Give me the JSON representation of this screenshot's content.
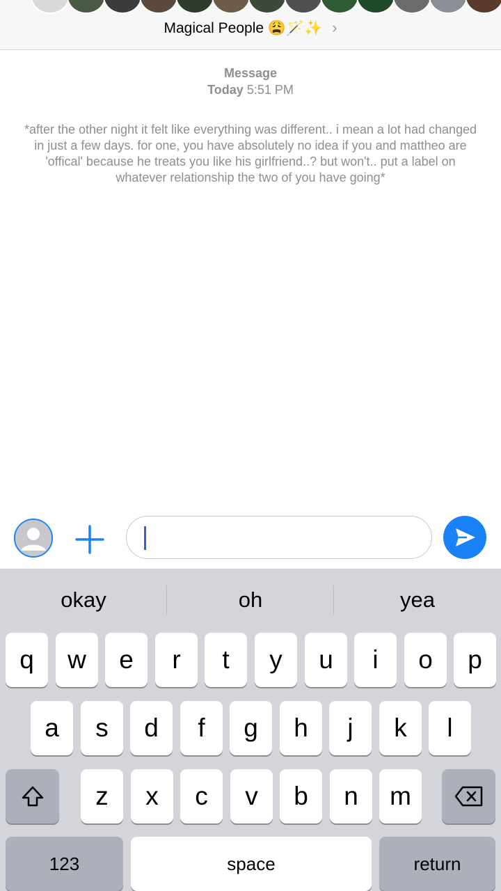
{
  "header": {
    "group_name": "Magical People",
    "group_emoji": "😩🪄✨",
    "chevron": "›",
    "avatar_colors": [
      "#d9d9d9",
      "#4a5a45",
      "#3a3a3a",
      "#5b4a3c",
      "#2f3b2d",
      "#6d5c48",
      "#3c4a3a",
      "#4f4f4f",
      "#2e5a35",
      "#1f4a2a",
      "#6b6b6b",
      "#8a8f95",
      "#5a3a2a",
      "#a08060"
    ]
  },
  "message": {
    "label": "Message",
    "date_bold": "Today",
    "time": "5:51 PM",
    "text": "*after the other night it felt like everything was different.. i mean a lot had changed in just a few days. for one, you have absolutely no idea if you and mattheo are 'offical' because he treats you like his girlfriend..? but won't.. put a label on whatever relationship the two of you have going*"
  },
  "input": {
    "value": "",
    "contact_icon": "person-icon",
    "plus_icon": "plus-icon",
    "send_icon": "send-icon",
    "accent": "#1a82f7"
  },
  "keyboard": {
    "suggestions": [
      "okay",
      "oh",
      "yea"
    ],
    "row1": [
      "q",
      "w",
      "e",
      "r",
      "t",
      "y",
      "u",
      "i",
      "o",
      "p"
    ],
    "row2": [
      "a",
      "s",
      "d",
      "f",
      "g",
      "h",
      "j",
      "k",
      "l"
    ],
    "row3": [
      "z",
      "x",
      "c",
      "v",
      "b",
      "n",
      "m"
    ],
    "shift_icon": "shift-icon",
    "delete_icon": "delete-icon",
    "numbers_label": "123",
    "space_label": "space",
    "return_label": "return"
  }
}
